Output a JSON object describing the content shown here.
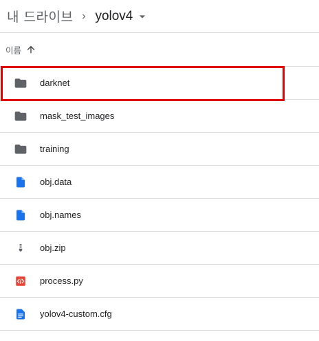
{
  "breadcrumb": {
    "root": "내 드라이브",
    "current": "yolov4"
  },
  "sort": {
    "label": "이름",
    "direction": "ascending"
  },
  "files": [
    {
      "name": "darknet",
      "type": "folder",
      "icon": "folder-icon",
      "color": "#5f6368",
      "selected": true
    },
    {
      "name": "mask_test_images",
      "type": "folder",
      "icon": "folder-icon",
      "color": "#5f6368"
    },
    {
      "name": "training",
      "type": "folder",
      "icon": "folder-icon",
      "color": "#5f6368"
    },
    {
      "name": "obj.data",
      "type": "file",
      "icon": "file-icon",
      "color": "#1a73e8"
    },
    {
      "name": "obj.names",
      "type": "file",
      "icon": "file-icon",
      "color": "#1a73e8"
    },
    {
      "name": "obj.zip",
      "type": "zip",
      "icon": "zip-icon",
      "color": "#5f6368"
    },
    {
      "name": "process.py",
      "type": "code",
      "icon": "code-file-icon",
      "color": "#ea4335"
    },
    {
      "name": "yolov4-custom.cfg",
      "type": "doc",
      "icon": "document-icon",
      "color": "#1a73e8"
    }
  ],
  "colors": {
    "highlight": "#e00000",
    "divider": "#dadce0"
  }
}
